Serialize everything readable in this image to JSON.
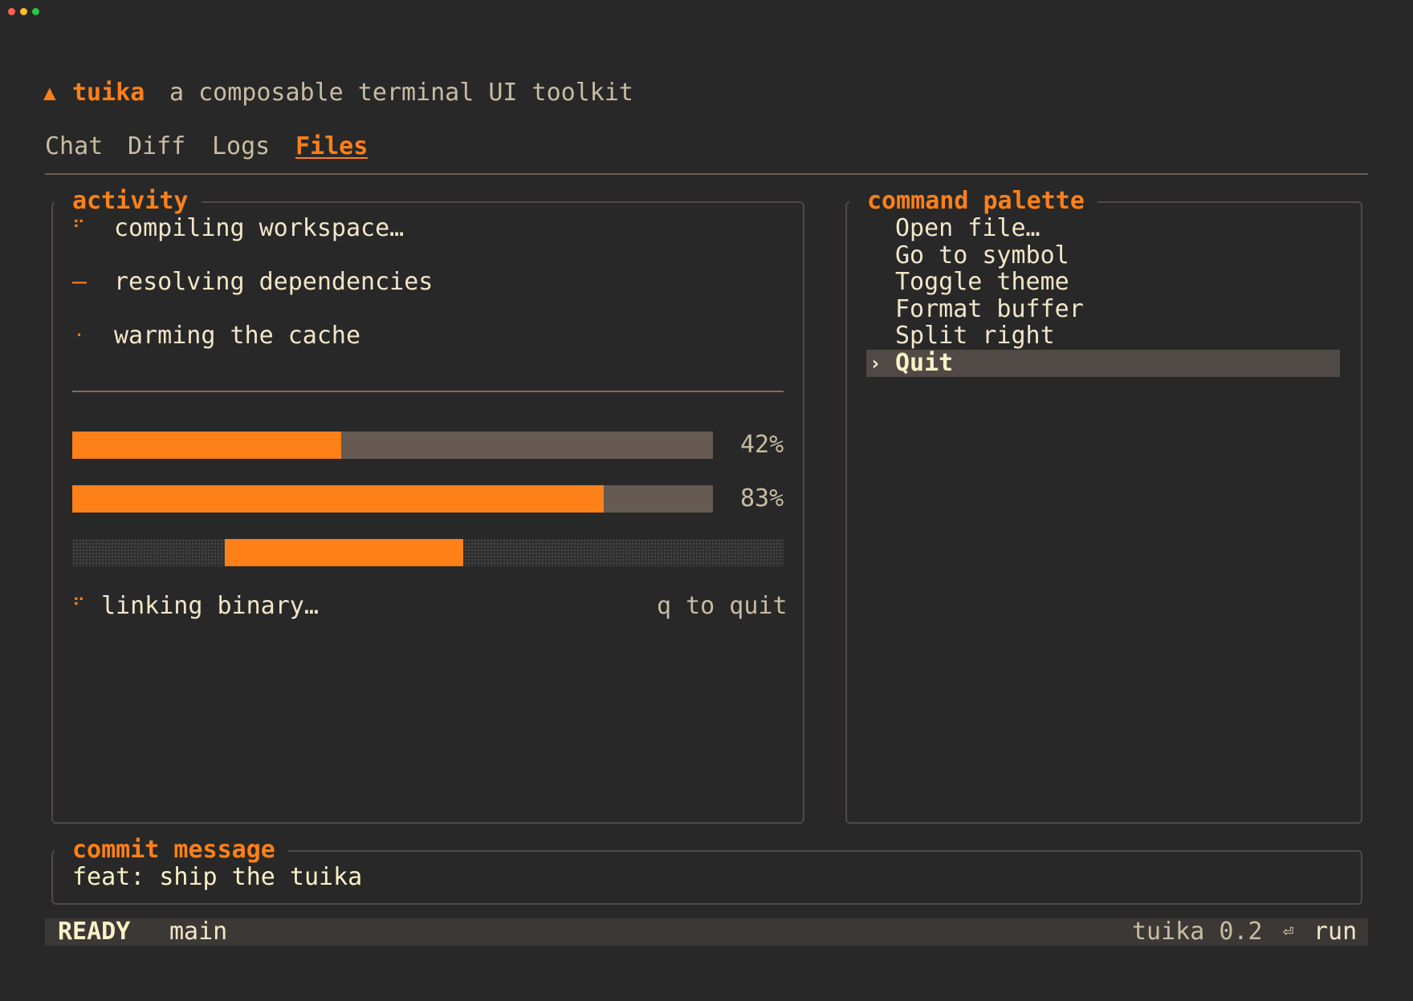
{
  "window": {
    "controls": [
      "close",
      "minimize",
      "zoom"
    ]
  },
  "header": {
    "logo_glyph": "▲",
    "app_name": "tuika",
    "tagline": "a composable terminal UI toolkit"
  },
  "tabs": [
    {
      "label": "Chat",
      "active": false
    },
    {
      "label": "Diff",
      "active": false
    },
    {
      "label": "Logs",
      "active": false
    },
    {
      "label": "Files",
      "active": true
    }
  ],
  "activity": {
    "title": "activity",
    "tasks": [
      {
        "spinner": "⠋",
        "text": "compiling workspace…"
      },
      {
        "spinner": "–",
        "text": "resolving dependencies"
      },
      {
        "spinner": "·",
        "text": "warming the cache"
      }
    ],
    "progress": [
      {
        "percent": 42,
        "label": "42%"
      },
      {
        "percent": 83,
        "label": "83%"
      }
    ],
    "indeterminate": {
      "start_fraction": 0.215,
      "end_fraction": 0.55
    },
    "footer": {
      "spinner": "⠋",
      "text": "linking binary…",
      "hint": "q to quit"
    }
  },
  "palette": {
    "title": "command palette",
    "cursor_glyph": "›",
    "items": [
      {
        "label": "Open file…",
        "selected": false
      },
      {
        "label": "Go to symbol",
        "selected": false
      },
      {
        "label": "Toggle theme",
        "selected": false
      },
      {
        "label": "Format buffer",
        "selected": false
      },
      {
        "label": "Split right",
        "selected": false
      },
      {
        "label": "Quit",
        "selected": true
      }
    ]
  },
  "commit": {
    "title": "commit message",
    "value": "feat: ship the tuika"
  },
  "statusbar": {
    "mode": "READY",
    "branch": "main",
    "version": "tuika 0.2",
    "enter_glyph": "⏎",
    "action": "run"
  },
  "colors": {
    "accent": "#fe8019",
    "background": "#282828",
    "text": "#f2e6c9",
    "muted": "#c8bca2",
    "track": "#665a52",
    "selection": "#504945"
  }
}
